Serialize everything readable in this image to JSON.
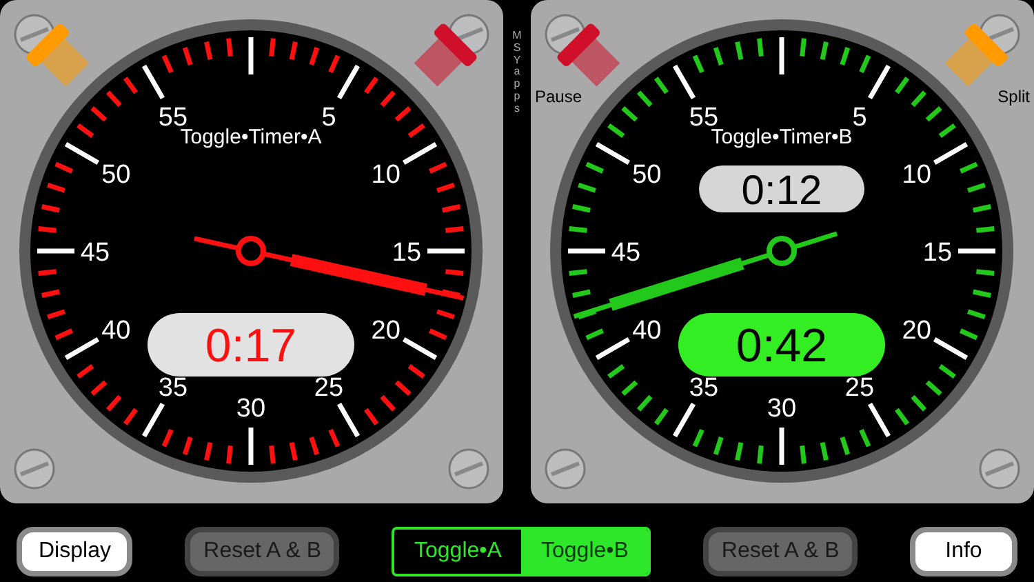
{
  "timers": [
    {
      "title": "Toggle•Timer•A",
      "color": "#ff1010",
      "dial_labels": [
        "5",
        "10",
        "15",
        "20",
        "25",
        "30",
        "35",
        "40",
        "45",
        "50",
        "55"
      ],
      "knobs": [
        {
          "color": "#ff9a00"
        },
        {
          "color": "#d0102a"
        }
      ],
      "readouts": [
        {
          "kind": "main",
          "text": "0:17",
          "running": false
        }
      ]
    },
    {
      "title": "Toggle•Timer•B",
      "color": "#22c81a",
      "dial_labels": [
        "5",
        "10",
        "15",
        "20",
        "25",
        "30",
        "35",
        "40",
        "45",
        "50",
        "55"
      ],
      "knobs": [
        {
          "color": "#d0102a",
          "label": "Pause"
        },
        {
          "color": "#ff9a00",
          "label": "Split"
        }
      ],
      "readouts": [
        {
          "kind": "split",
          "text": "0:12"
        },
        {
          "kind": "main",
          "text": "0:42",
          "running": true
        }
      ]
    }
  ],
  "brand": "MSYapps",
  "bottom_bar": [
    {
      "kind": "light",
      "label": "Display"
    },
    {
      "kind": "dark",
      "label": "Reset A & B"
    },
    {
      "kind": "segmented",
      "segments": [
        {
          "label": "Toggle•A",
          "selected": false
        },
        {
          "label": "Toggle•B",
          "selected": true
        }
      ]
    },
    {
      "kind": "dark",
      "label": "Reset A & B"
    },
    {
      "kind": "light",
      "label": "Info"
    }
  ]
}
